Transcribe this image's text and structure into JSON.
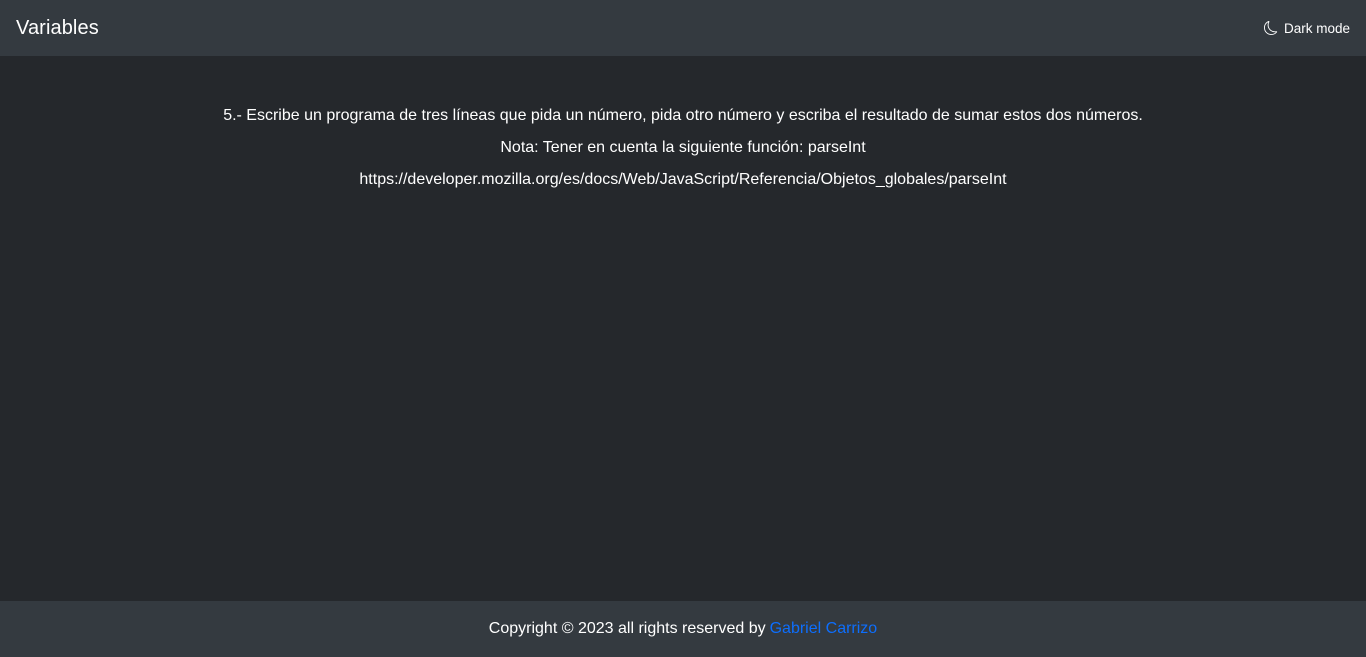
{
  "navbar": {
    "title": "Variables",
    "dark_mode_icon": "moon-icon",
    "dark_mode_label": "Dark mode"
  },
  "main": {
    "exercise": "5.- Escribe un programa de tres líneas que pida un número, pida otro número y escriba el resultado de sumar estos dos números.",
    "note": "Nota: Tener en cuenta la siguiente función: parseInt",
    "reference_url": "https://developer.mozilla.org/es/docs/Web/JavaScript/Referencia/Objetos_globales/parseInt"
  },
  "footer": {
    "copyright_text": "Copyright © 2023 all rights reserved by",
    "author_link": "Gabriel Carrizo",
    "link_color": "#0d6efd"
  },
  "colors": {
    "navbar_bg": "#343a40",
    "body_bg": "#25282c",
    "text": "#ffffff"
  }
}
